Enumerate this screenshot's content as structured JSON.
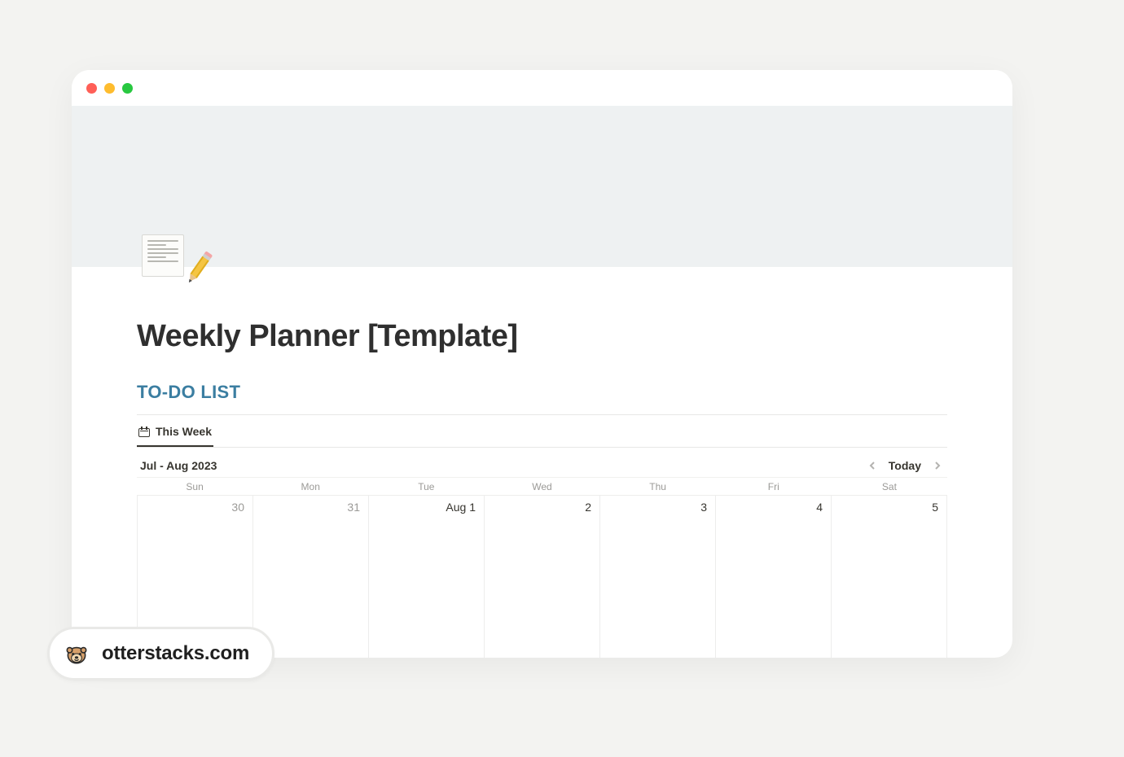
{
  "page": {
    "icon_name": "memo-pencil-icon",
    "title": "Weekly Planner [Template]",
    "section_title": "TO-DO LIST"
  },
  "tabs": {
    "active_label": "This Week"
  },
  "calendar": {
    "range_label": "Jul - Aug 2023",
    "today_label": "Today",
    "day_headers": [
      "Sun",
      "Mon",
      "Tue",
      "Wed",
      "Thu",
      "Fri",
      "Sat"
    ],
    "days": [
      {
        "label": "30",
        "muted": true
      },
      {
        "label": "31",
        "muted": true
      },
      {
        "label": "Aug 1",
        "muted": false
      },
      {
        "label": "2",
        "muted": false
      },
      {
        "label": "3",
        "muted": false
      },
      {
        "label": "4",
        "muted": false
      },
      {
        "label": "5",
        "muted": false
      }
    ]
  },
  "watermark": {
    "text": "otterstacks.com"
  },
  "colors": {
    "section_accent": "#3b7ea1",
    "muted_text": "#9b9a97"
  }
}
